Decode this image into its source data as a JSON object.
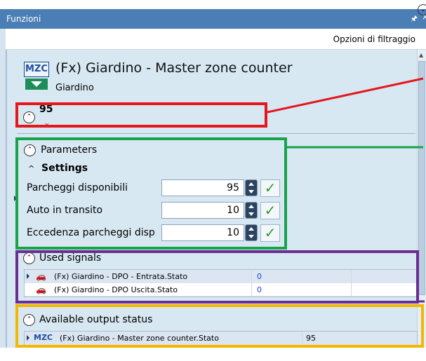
{
  "window": {
    "title": "Funzioni",
    "pin_icon": "pin-icon",
    "close_icon": "close-icon"
  },
  "filter": {
    "label": "Opzioni di filtraggio"
  },
  "function": {
    "icon_text": "MZC",
    "title": "(Fx) Giardino - Master zone counter",
    "subtitle": "Giardino",
    "value": "95"
  },
  "parameters": {
    "label": "Parameters",
    "settings_label": "Settings",
    "rows": [
      {
        "label": "Parcheggi disponibili",
        "value": "95"
      },
      {
        "label": "Auto in transito",
        "value": "10"
      },
      {
        "label": "Eccedenza parcheggi disp",
        "value": "10"
      }
    ]
  },
  "used_signals": {
    "label": "Used signals",
    "rows": [
      {
        "name": "(Fx) Giardino - DPO - Entrata.Stato",
        "value": "0"
      },
      {
        "name": "(Fx) Giardino - DPO Uscita.Stato",
        "value": "0"
      }
    ]
  },
  "available_output": {
    "label": "Available output status",
    "rows": [
      {
        "icon_text": "MZC",
        "name": "(Fx) Giardino - Master zone counter.Stato",
        "value": "95"
      }
    ]
  },
  "colors": {
    "red_box": "#e3171c",
    "green_box": "#16a34a",
    "purple_box": "#6b2d91",
    "yellow_box": "#f2b700",
    "titlebar": "#4a7eb5",
    "panel_bg": "#d7e8f2"
  }
}
